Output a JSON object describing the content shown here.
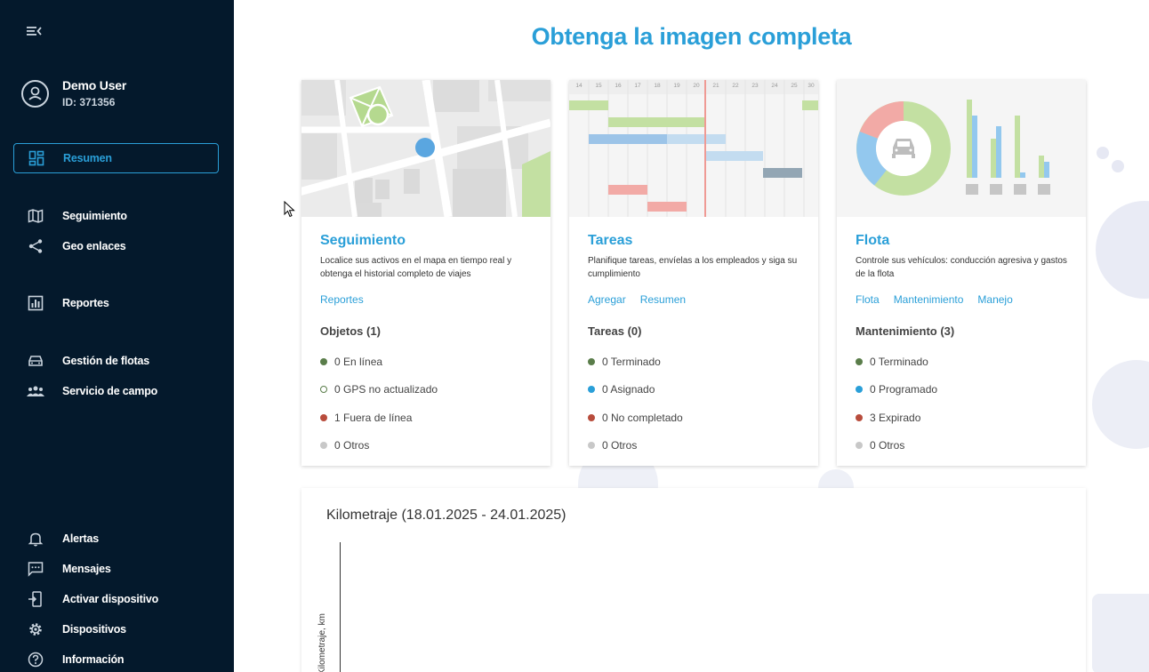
{
  "sidebar": {
    "user": {
      "name": "Demo User",
      "id": "ID: 371356"
    },
    "items": [
      {
        "label": "Resumen",
        "icon": "dashboard-icon"
      },
      {
        "label": "Seguimiento",
        "icon": "map-icon"
      },
      {
        "label": "Geo enlaces",
        "icon": "share-icon"
      },
      {
        "label": "Reportes",
        "icon": "chart-icon"
      },
      {
        "label": "Gestión de flotas",
        "icon": "car-icon"
      },
      {
        "label": "Servicio de campo",
        "icon": "group-icon"
      }
    ],
    "bottom_items": [
      {
        "label": "Alertas",
        "icon": "bell-icon"
      },
      {
        "label": "Mensajes",
        "icon": "message-icon"
      },
      {
        "label": "Activar dispositivo",
        "icon": "device-activate-icon"
      },
      {
        "label": "Dispositivos",
        "icon": "gear-icon"
      },
      {
        "label": "Información",
        "icon": "help-icon"
      }
    ]
  },
  "main": {
    "title": "Obtenga la imagen completa",
    "cards": [
      {
        "title": "Seguimiento",
        "desc": "Localice sus activos en el mapa en tiempo real y obtenga el historial completo de viajes",
        "links": [
          "Reportes"
        ],
        "subtitle": "Objetos (1)",
        "stats": [
          {
            "label": "0 En línea",
            "color": "#5a7d4a",
            "style": "filled"
          },
          {
            "label": "0 GPS no actualizado",
            "color": "#5a7d4a",
            "style": "ring"
          },
          {
            "label": "1 Fuera de línea",
            "color": "#b84c3c",
            "style": "filled"
          },
          {
            "label": "0 Otros",
            "color": "#c8c8c8",
            "style": "filled"
          }
        ]
      },
      {
        "title": "Tareas",
        "desc": "Planifique tareas, envíelas a los empleados y siga su cumplimiento",
        "links": [
          "Agregar",
          "Resumen"
        ],
        "subtitle": "Tareas (0)",
        "stats": [
          {
            "label": "0 Terminado",
            "color": "#5a7d4a",
            "style": "filled"
          },
          {
            "label": "0 Asignado",
            "color": "#2a9fd8",
            "style": "filled"
          },
          {
            "label": "0 No completado",
            "color": "#b84c3c",
            "style": "filled"
          },
          {
            "label": "0 Otros",
            "color": "#c8c8c8",
            "style": "filled"
          }
        ]
      },
      {
        "title": "Flota",
        "desc": "Controle sus vehículos: conducción agresiva y gastos de la flota",
        "links": [
          "Flota",
          "Mantenimiento",
          "Manejo"
        ],
        "subtitle": "Mantenimiento (3)",
        "stats": [
          {
            "label": "0 Terminado",
            "color": "#5a7d4a",
            "style": "filled"
          },
          {
            "label": "0 Programado",
            "color": "#2a9fd8",
            "style": "filled"
          },
          {
            "label": "3 Expirado",
            "color": "#b84c3c",
            "style": "filled"
          },
          {
            "label": "0 Otros",
            "color": "#c8c8c8",
            "style": "filled"
          }
        ]
      }
    ],
    "gantt_days": [
      "14",
      "15",
      "16",
      "17",
      "18",
      "19",
      "20",
      "21",
      "22",
      "23",
      "24",
      "25",
      "30"
    ],
    "mileage": {
      "title": "Kilometraje (18.01.2025 - 24.01.2025)",
      "ylabel": "Kilometraje, km"
    }
  },
  "colors": {
    "sidebar_bg": "#04192c",
    "accent": "#2a9fd8"
  }
}
